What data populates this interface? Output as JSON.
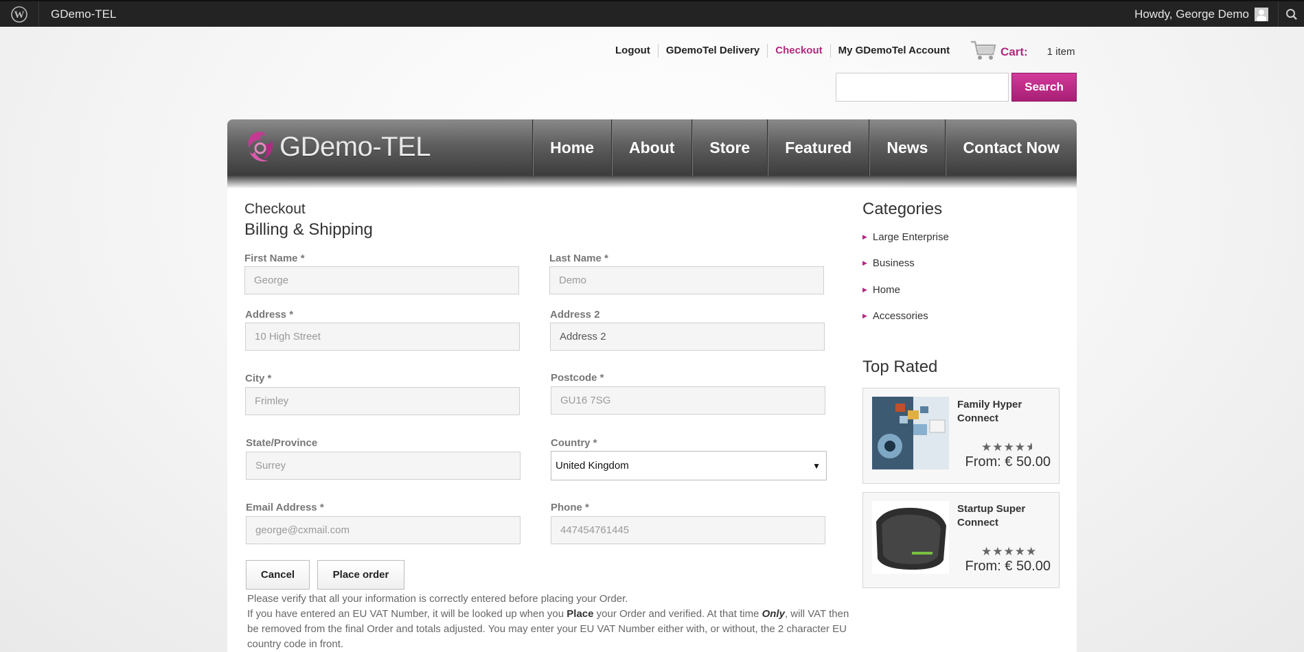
{
  "adminbar": {
    "site_name": "GDemo-TEL",
    "howdy": "Howdy, George Demo"
  },
  "toplinks": [
    {
      "label": "Logout"
    },
    {
      "label": "GDemoTel Delivery"
    },
    {
      "label": "Checkout"
    },
    {
      "label": "My GDemoTel Account"
    }
  ],
  "cart": {
    "label": "Cart:",
    "count": "1 item"
  },
  "search": {
    "button": "Search",
    "value": ""
  },
  "header": {
    "logo_text": "GDemo-TEL",
    "nav": [
      "Home",
      "About",
      "Store",
      "Featured",
      "News",
      "Contact Now"
    ]
  },
  "checkout": {
    "title": "Checkout",
    "subtitle": "Billing & Shipping",
    "fields": {
      "first_name": {
        "label": "First Name *",
        "value": "George"
      },
      "last_name": {
        "label": "Last Name *",
        "value": "Demo"
      },
      "address": {
        "label": "Address *",
        "value": "10 High Street"
      },
      "address2": {
        "label": "Address 2",
        "value": "Address 2"
      },
      "city": {
        "label": "City *",
        "value": "Frimley"
      },
      "postcode": {
        "label": "Postcode *",
        "value": "GU16 7SG"
      },
      "state": {
        "label": "State/Province",
        "value": "Surrey"
      },
      "country": {
        "label": "Country *",
        "value": "United Kingdom"
      },
      "email": {
        "label": "Email Address *",
        "value": "george@cxmail.com"
      },
      "phone": {
        "label": "Phone *",
        "value": "447454761445"
      }
    },
    "buttons": {
      "cancel": "Cancel",
      "place_order": "Place order"
    },
    "note_line1": "Please verify that all your information is correctly entered before placing your Order.",
    "note_p1": "If you have entered an EU VAT Number, it will be looked up when you ",
    "note_b1": "Place",
    "note_p2": " your Order and verified. At that time ",
    "note_b2": "Only",
    "note_p3": ", will VAT then be removed from the final Order and totals adjusted. You may enter your EU VAT Number either with, or without, the 2 character EU country code in front."
  },
  "sidebar": {
    "categories_title": "Categories",
    "categories": [
      "Large Enterprise",
      "Business",
      "Home",
      "Accessories"
    ],
    "top_rated_title": "Top Rated",
    "products": [
      {
        "name": "Family Hyper Connect",
        "price": "From: € 50.00",
        "rating": 4.5
      },
      {
        "name": "Startup Super Connect",
        "price": "From: € 50.00",
        "rating": 5
      }
    ]
  },
  "colors": {
    "accent": "#b3287f",
    "header_dark": "#3c3c3c"
  }
}
